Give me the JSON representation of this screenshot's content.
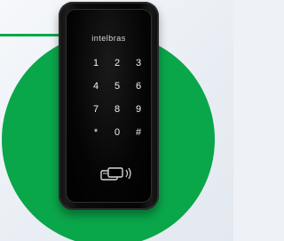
{
  "device": {
    "brand": "intelbras",
    "keys": [
      "1",
      "2",
      "3",
      "4",
      "5",
      "6",
      "7",
      "8",
      "9",
      "*",
      "0",
      "#"
    ],
    "card_reader_icon": "contactless-card-icon"
  },
  "colors": {
    "accent_green": "#0aa64a",
    "device_body": "#0b0b0b",
    "key_text": "#f2f2f2"
  }
}
